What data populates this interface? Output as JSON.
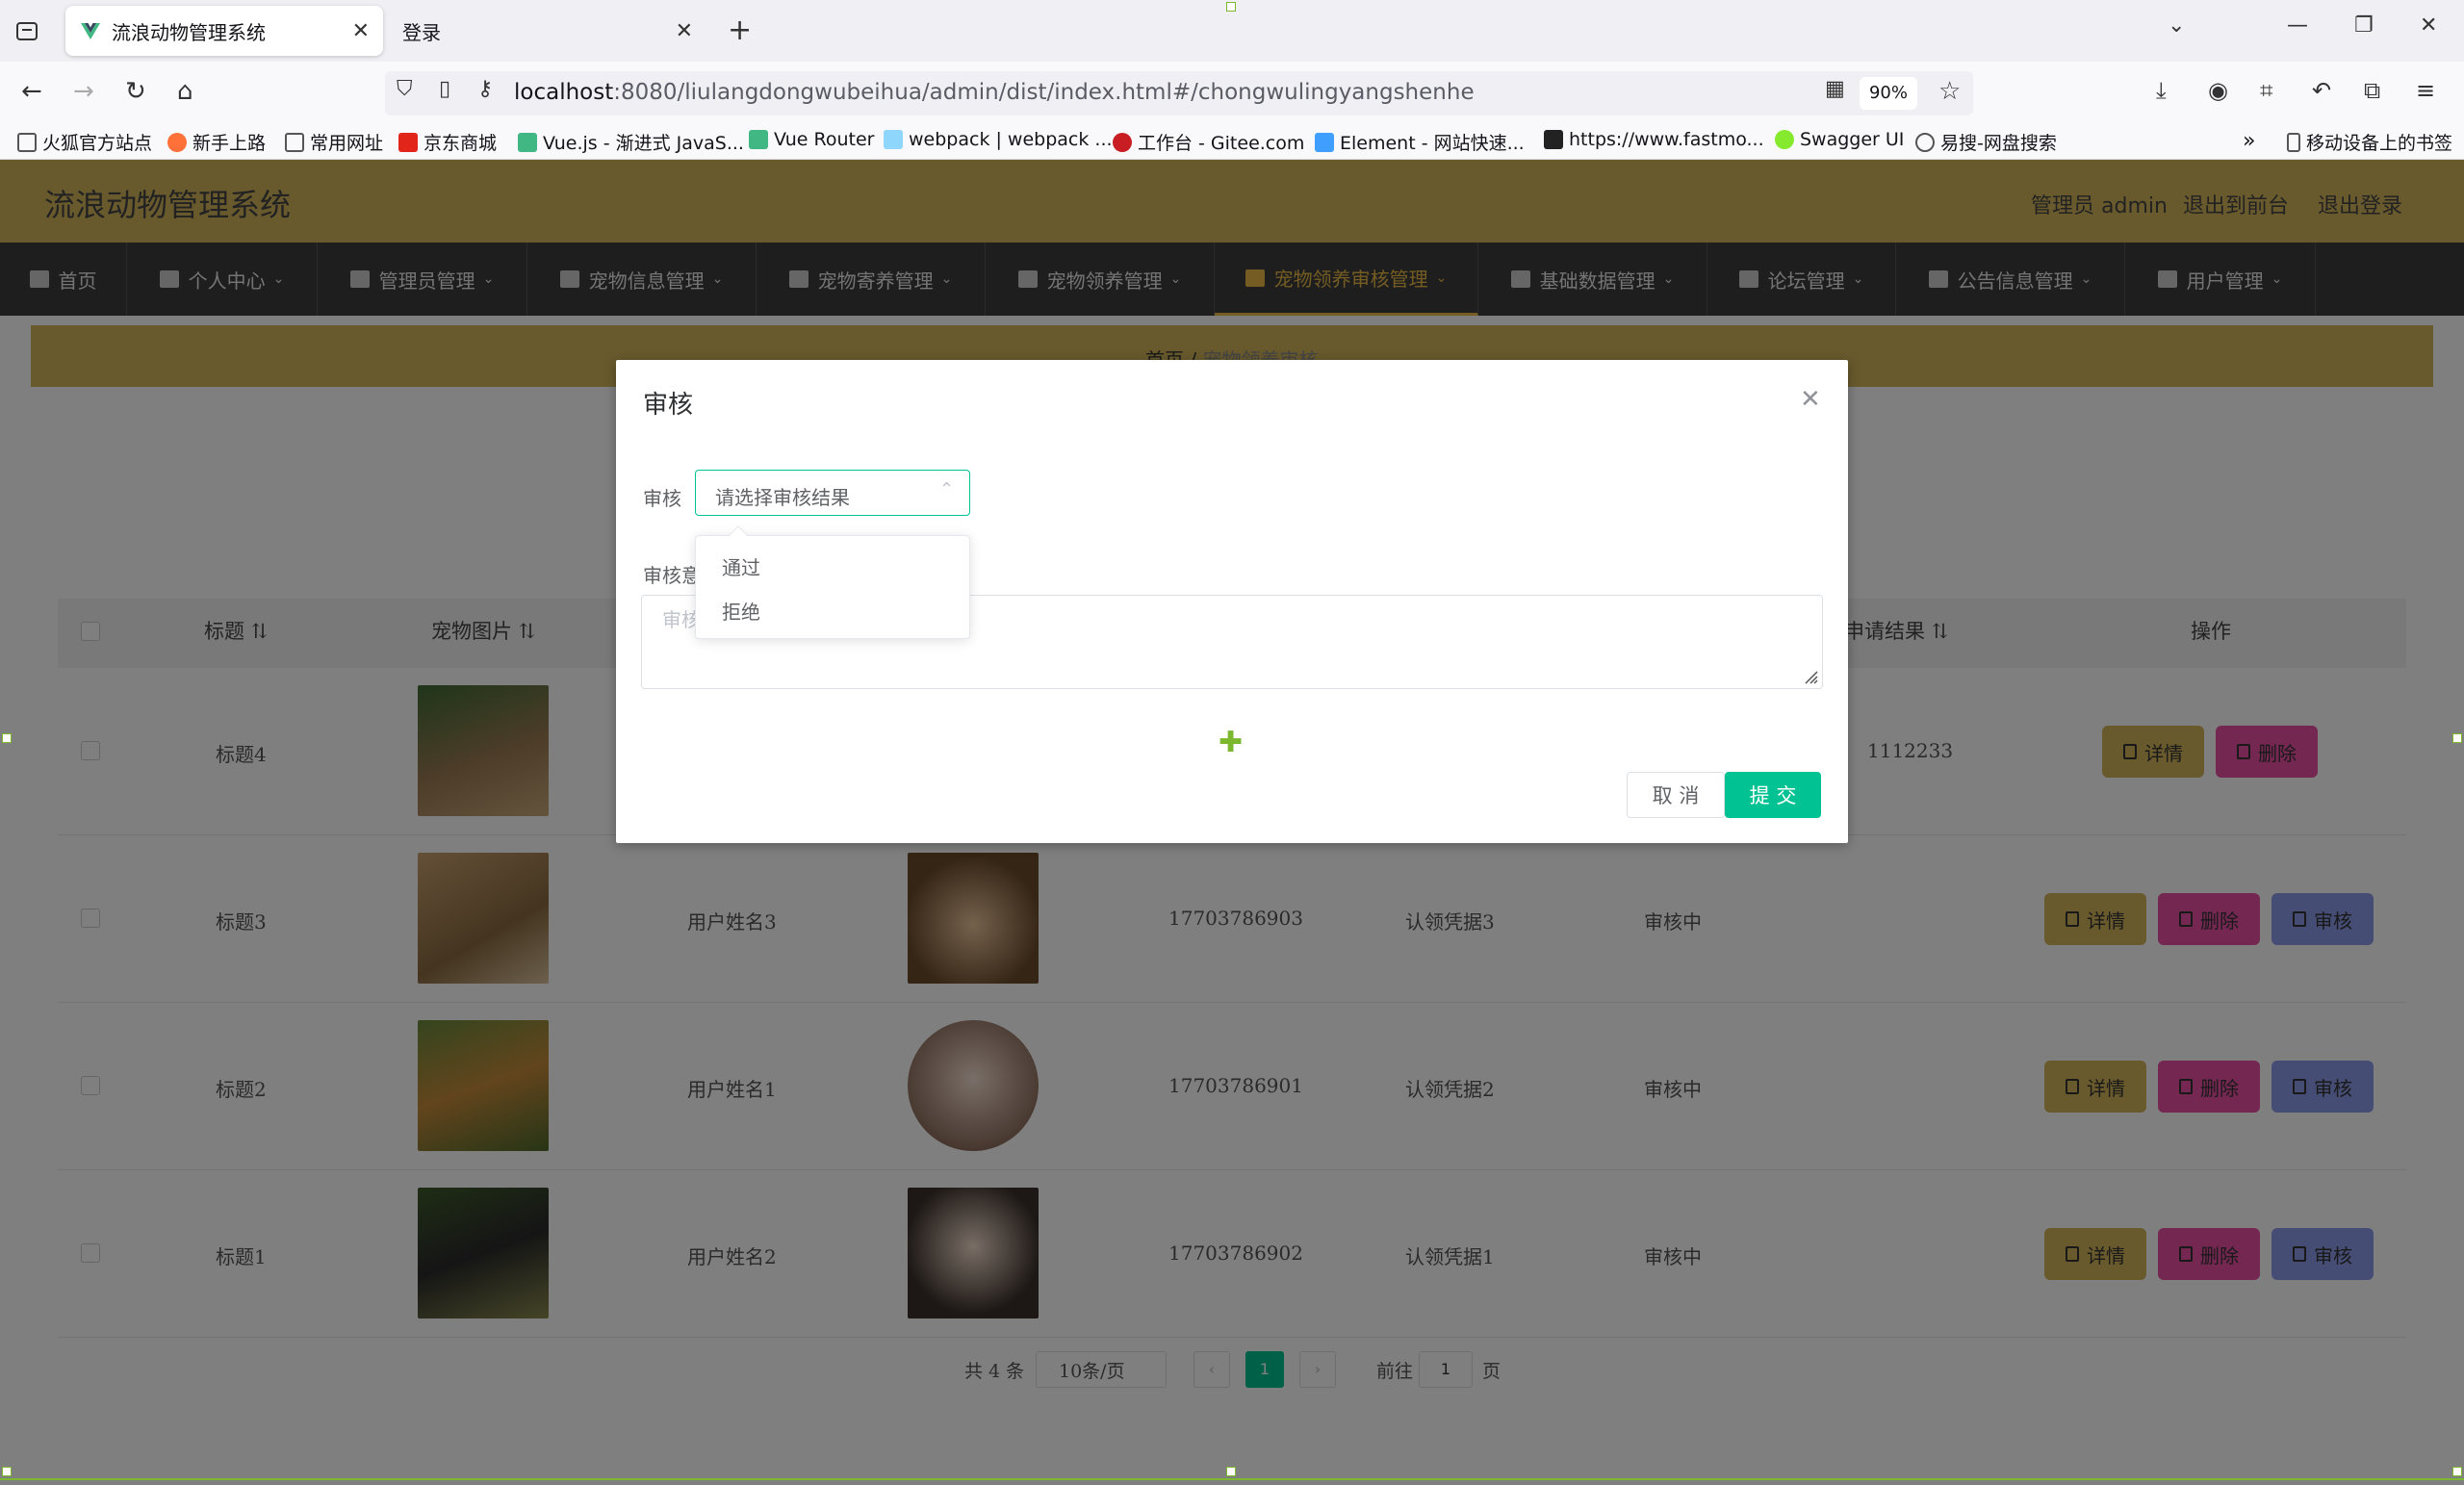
{
  "browser": {
    "tabs": [
      {
        "title": "流浪动物管理系统",
        "active": true
      },
      {
        "title": "登录",
        "active": false
      }
    ],
    "url_host": "localhost",
    "url_rest": ":8080/liulangdongwubeihua/admin/dist/index.html#/chongwulingyangshenhe",
    "zoom": "90%",
    "bookmarks": [
      "火狐官方站点",
      "新手上路",
      "常用网址",
      "京东商城",
      "Vue.js - 渐进式 JavaS...",
      "Vue Router",
      "webpack | webpack ...",
      "工作台 - Gitee.com",
      "Element - 网站快速...",
      "https://www.fastmo...",
      "Swagger UI",
      "易搜-网盘搜索",
      "移动设备上的书签"
    ]
  },
  "header": {
    "title": "流浪动物管理系统",
    "links": [
      "管理员 admin",
      "退出到前台",
      "退出登录"
    ]
  },
  "menu": [
    "首页",
    "个人中心",
    "管理员管理",
    "宠物信息管理",
    "宠物寄养管理",
    "宠物领养管理",
    "宠物领养审核管理",
    "基础数据管理",
    "论坛管理",
    "公告信息管理",
    "用户管理"
  ],
  "breadcrumb": {
    "home": "首页",
    "sep": "/",
    "current": "宠物领养审核"
  },
  "table": {
    "headers": [
      "标题",
      "宠物图片",
      "申请结果",
      "操作"
    ],
    "rows": [
      {
        "title": "标题4",
        "name": "",
        "phone": "",
        "proof": "",
        "status": "",
        "result": "1112233",
        "has_review": false
      },
      {
        "title": "标题3",
        "name": "用户姓名3",
        "phone": "17703786903",
        "proof": "认领凭据3",
        "status": "审核中",
        "result": "",
        "has_review": true
      },
      {
        "title": "标题2",
        "name": "用户姓名1",
        "phone": "17703786901",
        "proof": "认领凭据2",
        "status": "审核中",
        "result": "",
        "has_review": true
      },
      {
        "title": "标题1",
        "name": "用户姓名2",
        "phone": "17703786902",
        "proof": "认领凭据1",
        "status": "审核中",
        "result": "",
        "has_review": true
      }
    ],
    "buttons": {
      "detail": "详情",
      "delete": "删除",
      "review": "审核"
    }
  },
  "pager": {
    "total": "共 4 条",
    "size": "10条/页",
    "current": "1",
    "goto": "前往",
    "goto_value": "1",
    "page_unit": "页"
  },
  "dialog": {
    "title": "审核",
    "review_label": "审核",
    "select_placeholder": "请选择审核结果",
    "options": [
      "通过",
      "拒绝"
    ],
    "opinion_label": "审核意",
    "opinion_placeholder": "审核",
    "cancel": "取 消",
    "submit": "提 交"
  },
  "colors": {
    "accent": "#d2b45b",
    "primary": "#00c292",
    "menu_bg": "#3d3d3d",
    "delete": "#e64fa2",
    "review": "#8c9ae8"
  }
}
